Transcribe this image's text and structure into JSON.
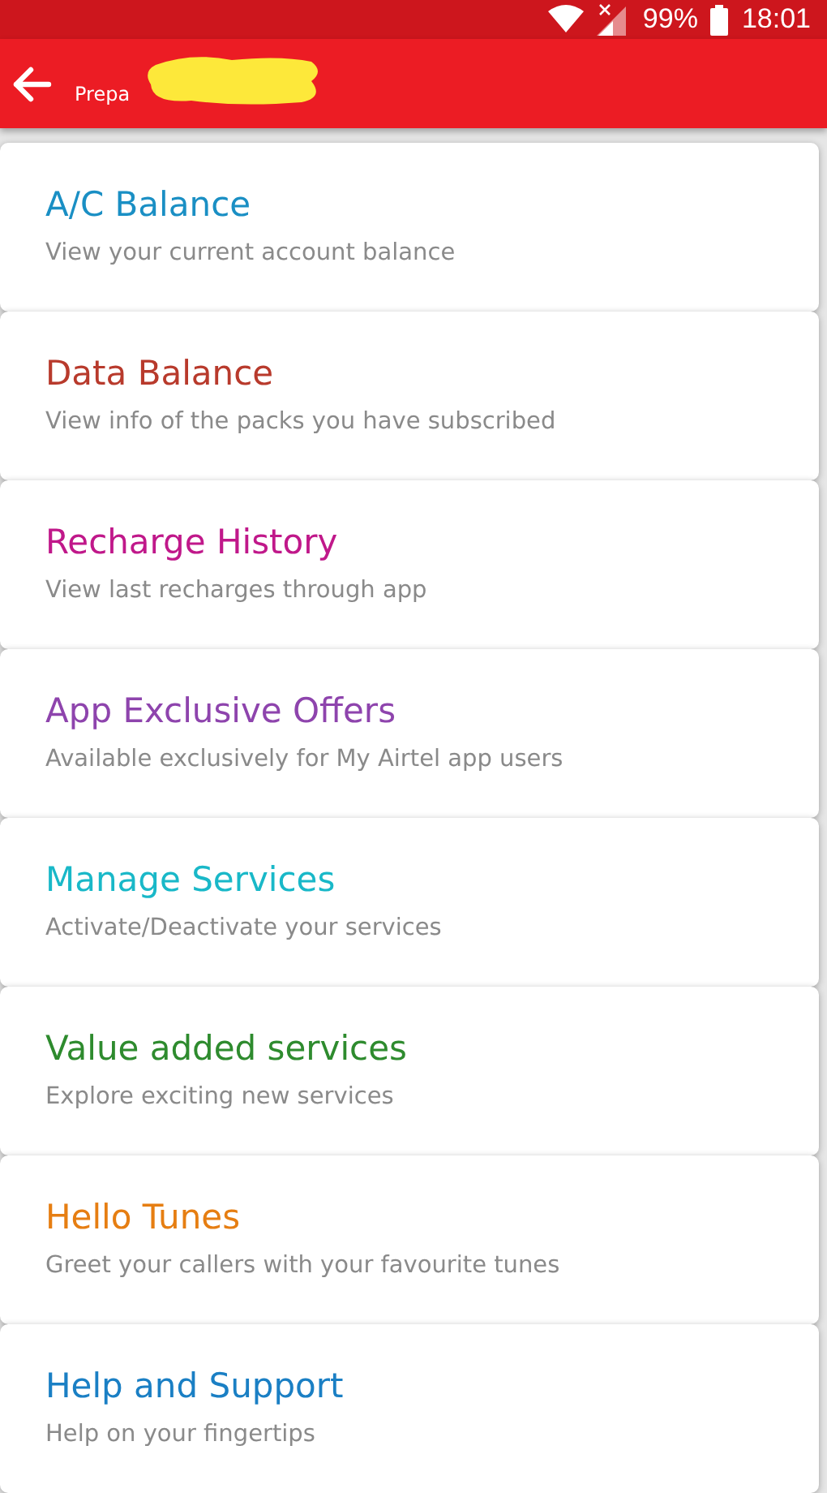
{
  "status_bar": {
    "battery": "99%",
    "time": "18:01"
  },
  "header": {
    "subtitle": "Prepa"
  },
  "menu": [
    {
      "title": "A/C Balance",
      "description": "View your current account balance",
      "color": "#1a8fc4"
    },
    {
      "title": "Data Balance",
      "description": "View info of the packs you have subscribed",
      "color": "#b83a2c"
    },
    {
      "title": "Recharge History",
      "description": "View last recharges through app",
      "color": "#c0188a"
    },
    {
      "title": "App Exclusive Offers",
      "description": "Available exclusively for My Airtel app users",
      "color": "#8e44ad"
    },
    {
      "title": "Manage Services",
      "description": "Activate/Deactivate your services",
      "color": "#19b8c8"
    },
    {
      "title": "Value added services",
      "description": "Explore exciting new services",
      "color": "#2e8b2e"
    },
    {
      "title": "Hello Tunes",
      "description": "Greet your callers with your favourite tunes",
      "color": "#e67e12"
    },
    {
      "title": "Help and Support",
      "description": "Help on your fingertips",
      "color": "#1a7fc4"
    }
  ]
}
